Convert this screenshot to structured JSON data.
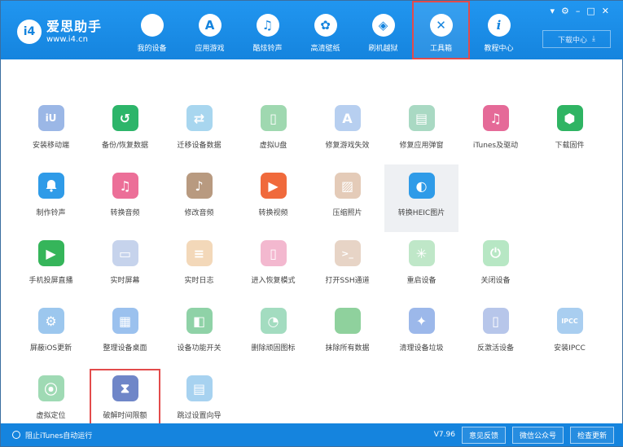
{
  "app": {
    "name": "爱思助手",
    "url": "www.i4.cn",
    "logo_mark": "i4"
  },
  "nav": [
    {
      "label": "我的设备",
      "icon": "apple-icon",
      "glyph": ""
    },
    {
      "label": "应用游戏",
      "icon": "app-store-icon",
      "glyph": "A"
    },
    {
      "label": "酷炫铃声",
      "icon": "bell-icon",
      "glyph": "♫"
    },
    {
      "label": "高清壁纸",
      "icon": "flower-icon",
      "glyph": "✿"
    },
    {
      "label": "刷机越狱",
      "icon": "box-icon",
      "glyph": "◈"
    },
    {
      "label": "工具箱",
      "icon": "tools-icon",
      "glyph": "✕"
    },
    {
      "label": "教程中心",
      "icon": "info-icon",
      "glyph": "i"
    }
  ],
  "window_controls": [
    "▾",
    "⚙",
    "–",
    "□",
    "✕"
  ],
  "download_center": {
    "label": "下载中心",
    "icon": "download-icon",
    "glyph": "⤓"
  },
  "tiles": [
    [
      {
        "label": "安装移动端",
        "icon": "i4-mobile-icon",
        "glyph": "iU",
        "color": "#9bb7e6"
      },
      {
        "label": "备份/恢复数据",
        "icon": "backup-restore-icon",
        "glyph": "↺",
        "color": "#2db56a"
      },
      {
        "label": "迁移设备数据",
        "icon": "migrate-data-icon",
        "glyph": "⇄",
        "color": "#a8d6ef"
      },
      {
        "label": "虚拟U盘",
        "icon": "usb-drive-icon",
        "glyph": "▯",
        "color": "#9fd8b0"
      },
      {
        "label": "修复游戏失效",
        "icon": "fix-game-icon",
        "glyph": "A",
        "color": "#b7cff0"
      },
      {
        "label": "修复应用弹窗",
        "icon": "fix-popup-icon",
        "glyph": "▤",
        "color": "#a9d9c3"
      },
      {
        "label": "iTunes及驱动",
        "icon": "itunes-icon",
        "glyph": "♫",
        "color": "#e56a98"
      },
      {
        "label": "下载固件",
        "icon": "firmware-icon",
        "glyph": "⬢",
        "color": "#2fb463"
      }
    ],
    [
      {
        "label": "制作铃声",
        "icon": "ringtone-icon",
        "glyph": "🔔",
        "color": "#2f9be8"
      },
      {
        "label": "转换音频",
        "icon": "convert-audio-icon",
        "glyph": "♫",
        "color": "#ec6f98"
      },
      {
        "label": "修改音频",
        "icon": "edit-audio-icon",
        "glyph": "♪",
        "color": "#b89a80"
      },
      {
        "label": "转换视频",
        "icon": "convert-video-icon",
        "glyph": "▶",
        "color": "#f06a3c"
      },
      {
        "label": "压缩照片",
        "icon": "compress-photo-icon",
        "glyph": "▨",
        "color": "#e4cbb8"
      },
      {
        "label": "转换HEIC图片",
        "icon": "heic-icon",
        "glyph": "◐",
        "color": "#2f9be8"
      }
    ],
    [
      {
        "label": "手机投屏直播",
        "icon": "screen-cast-icon",
        "glyph": "▶",
        "color": "#35b55a"
      },
      {
        "label": "实时屏幕",
        "icon": "live-screen-icon",
        "glyph": "▭",
        "color": "#c6d3ec"
      },
      {
        "label": "实时日志",
        "icon": "live-log-icon",
        "glyph": "≡",
        "color": "#f3d8b9"
      },
      {
        "label": "进入恢复模式",
        "icon": "recovery-mode-icon",
        "glyph": "▯",
        "color": "#f3b8cf"
      },
      {
        "label": "打开SSH通道",
        "icon": "ssh-icon",
        "glyph": ">_",
        "color": "#e7d4c6"
      },
      {
        "label": "重启设备",
        "icon": "restart-icon",
        "glyph": "✳",
        "color": "#bfe7c8"
      },
      {
        "label": "关闭设备",
        "icon": "power-icon",
        "glyph": "⏻",
        "color": "#b7e7c4"
      }
    ],
    [
      {
        "label": "屏蔽iOS更新",
        "icon": "block-update-icon",
        "glyph": "⚙",
        "color": "#9cc7ee"
      },
      {
        "label": "整理设备桌面",
        "icon": "organize-desktop-icon",
        "glyph": "▦",
        "color": "#9bc1ee"
      },
      {
        "label": "设备功能开关",
        "icon": "feature-toggle-icon",
        "glyph": "◧",
        "color": "#8fd2a7"
      },
      {
        "label": "删除顽固图标",
        "icon": "delete-icon-icon",
        "glyph": "◔",
        "color": "#a3dcc0"
      },
      {
        "label": "抹除所有数据",
        "icon": "erase-data-icon",
        "glyph": "",
        "color": "#8fd19d"
      },
      {
        "label": "清理设备垃圾",
        "icon": "clean-junk-icon",
        "glyph": "✦",
        "color": "#9cb8ea"
      },
      {
        "label": "反激活设备",
        "icon": "deactivate-icon",
        "glyph": "▯",
        "color": "#b7c6ea"
      },
      {
        "label": "安装IPCC",
        "icon": "ipcc-icon",
        "glyph": "IPCC",
        "color": "#a9cef0"
      }
    ],
    [
      {
        "label": "虚拟定位",
        "icon": "location-icon",
        "glyph": "⦿",
        "color": "#9fdab4"
      },
      {
        "label": "破解时间限额",
        "icon": "hourglass-icon",
        "glyph": "⧗",
        "color": "#6f86c8"
      },
      {
        "label": "跳过设置向导",
        "icon": "skip-setup-icon",
        "glyph": "▤",
        "color": "#a7d2f0"
      }
    ]
  ],
  "status": {
    "left_label": "阻止iTunes自动运行",
    "version": "V7.96",
    "buttons": [
      "意见反馈",
      "微信公众号",
      "检查更新"
    ]
  }
}
